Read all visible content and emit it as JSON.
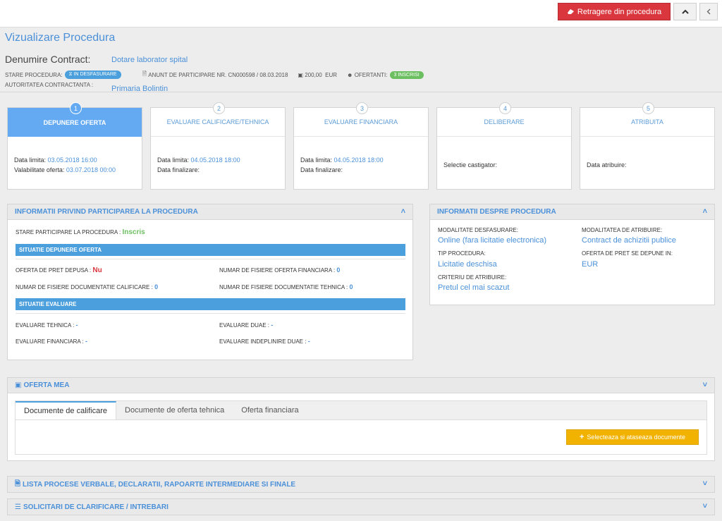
{
  "topbar": {
    "withdraw_label": "Retragere din procedura",
    "up_icon": "chevron-up-icon",
    "back_icon": "chevron-left-icon"
  },
  "header": {
    "title": "Vizualizare Procedura",
    "contract_label": "Denumire Contract:",
    "contract_value": "Dotare laborator spital",
    "status_label": "STARE PROCEDURA:",
    "status_badge": "IN DESFASURARE",
    "notice_label": "ANUNT DE PARTICIPARE NR. CN000598 / 08.03.2018",
    "amount": "200,00",
    "currency": "EUR",
    "bidders_label": "OFERTANTI:",
    "bidders_badge": "3 INSCRISI",
    "authority_label": "AUTORITATEA CONTRACTANTA :",
    "authority_value": "Primaria Bolintin",
    "colors": {
      "accent": "#4a90d9",
      "danger": "#d9363e",
      "success": "#6cbf60",
      "warning": "#f2b300"
    }
  },
  "steps": [
    {
      "num": "1",
      "title": "DEPUNERE OFERTA",
      "lines": [
        {
          "label": "Data limita:",
          "value": "03.05.2018 16:00"
        },
        {
          "label": "Valabilitate oferta:",
          "value": "03.07.2018 00:00"
        }
      ]
    },
    {
      "num": "2",
      "title": "EVALUARE CALIFICARE/TEHNICA",
      "lines": [
        {
          "label": "Data limita:",
          "value": "04.05.2018 18:00"
        },
        {
          "label": "Data finalizare:",
          "value": ""
        }
      ]
    },
    {
      "num": "3",
      "title": "EVALUARE FINANCIARA",
      "lines": [
        {
          "label": "Data limita:",
          "value": "04.05.2018 18:00"
        },
        {
          "label": "Data finalizare:",
          "value": ""
        }
      ]
    },
    {
      "num": "4",
      "title": "DELIBERARE",
      "lines": [
        {
          "label": "Selectie castigator:",
          "value": ""
        }
      ]
    },
    {
      "num": "5",
      "title": "ATRIBUITA",
      "lines": [
        {
          "label": "Data atribuire:",
          "value": ""
        }
      ]
    }
  ],
  "participation": {
    "title": "INFORMATII PRIVIND PARTICIPAREA LA PROCEDURA",
    "status_label": "STARE PARTICIPARE LA PROCEDURA :",
    "status_value": "Inscris",
    "submission_bar": "SITUATIE DEPUNERE OFERTA",
    "offer_label": "OFERTA DE PRET DEPUSA :",
    "offer_value": "Nu",
    "fin_files_label": "NUMAR DE FISIERE OFERTA FINANCIARA :",
    "fin_files_value": "0",
    "qual_files_label": "NUMAR DE FISIERE DOCUMENTATIE CALIFICARE :",
    "qual_files_value": "0",
    "tech_files_label": "NUMAR DE FISIERE DOCUMENTATIE TEHNICA :",
    "tech_files_value": "0",
    "eval_bar": "SITUATIE EVALUARE",
    "eval_tech_label": "EVALUARE TEHNICA :",
    "eval_tech_value": "-",
    "eval_duae_label": "EVALUARE DUAE :",
    "eval_duae_value": "-",
    "eval_fin_label": "EVALUARE FINANCIARA :",
    "eval_fin_value": "-",
    "eval_duae_compl_label": "EVALUARE INDEPLINIRE DUAE :",
    "eval_duae_compl_value": "-"
  },
  "procedure": {
    "title": "INFORMATII DESPRE PROCEDURA",
    "mode_label": "MODALITATE DESFASURARE:",
    "mode_value": "Online (fara licitatie electronica)",
    "award_mode_label": "MODALITATEA DE ATRIBUIRE:",
    "award_mode_value": "Contract de achizitii publice",
    "type_label": "TIP PROCEDURA:",
    "type_value": "Licitatie deschisa",
    "currency_label": "OFERTA DE PRET SE DEPUNE IN:",
    "currency_value": "EUR",
    "criteria_label": "CRITERIU DE ATRIBUIRE:",
    "criteria_value": "Pretul cel mai scazut"
  },
  "my_offer": {
    "title": "OFERTA MEA",
    "tabs": [
      "Documente de calificare",
      "Documente de oferta tehnica",
      "Oferta financiara"
    ],
    "select_button": "Selecteaza si ataseaza documente"
  },
  "reports": {
    "title": "LISTA PROCESE VERBALE, DECLARATII, RAPOARTE INTERMEDIARE SI FINALE"
  },
  "clarifications": {
    "title": "SOLICITARI DE CLARIFICARE / INTREBARI"
  }
}
